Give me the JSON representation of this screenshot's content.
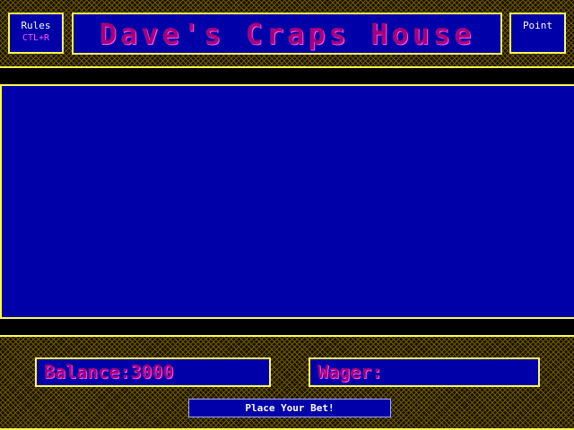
{
  "header": {
    "rules_label": "Rules",
    "rules_shortcut": "CTL+R",
    "title": "Dave's Craps House",
    "point_label": "Point",
    "point_value": ""
  },
  "footer": {
    "balance_label": "Balance:",
    "balance_value": "3000",
    "wager_label": "Wager:",
    "wager_value": "",
    "bet_button_label": "Place Your Bet!"
  },
  "colors": {
    "panel_blue": "#0000a8",
    "border_yellow": "#fcfc54",
    "title_magenta": "#a8007a",
    "text_white": "#fcfcfc"
  }
}
